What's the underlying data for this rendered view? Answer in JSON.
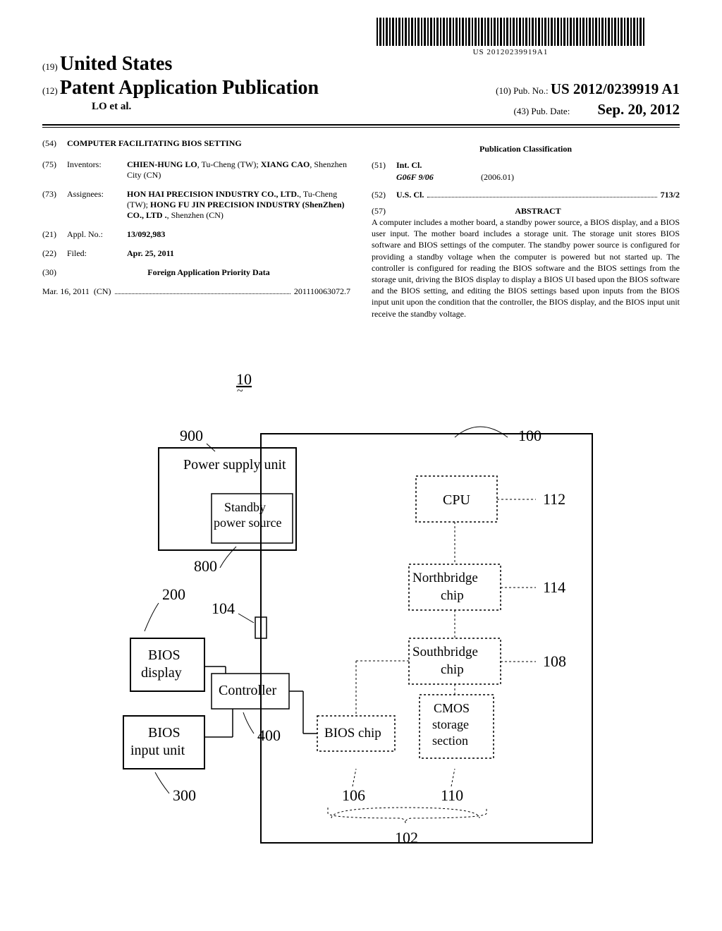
{
  "barcode_text": "US 20120239919A1",
  "country_code": "(19)",
  "country_name": "United States",
  "pub_type_code": "(12)",
  "pub_type": "Patent Application Publication",
  "pub_num_code": "(10)",
  "pub_num_label": "Pub. No.:",
  "pub_num_value": "US 2012/0239919 A1",
  "authors": "LO et al.",
  "pub_date_code": "(43)",
  "pub_date_label": "Pub. Date:",
  "pub_date_value": "Sep. 20, 2012",
  "title_code": "(54)",
  "title_value": "COMPUTER FACILITATING BIOS SETTING",
  "inventors_code": "(75)",
  "inventors_label": "Inventors:",
  "inventors_value_1": "CHIEN-HUNG LO",
  "inventors_loc_1": ", Tu-Cheng (TW); ",
  "inventors_value_2": "XIANG CAO",
  "inventors_loc_2": ", Shenzhen City (CN)",
  "assignees_code": "(73)",
  "assignees_label": "Assignees:",
  "assignees_value_1": "HON HAI PRECISION INDUSTRY CO., LTD.",
  "assignees_loc_1": ", Tu-Cheng (TW); ",
  "assignees_value_2": "HONG FU JIN PRECISION INDUSTRY (ShenZhen) CO., LTD .",
  "assignees_loc_2": ", Shenzhen (CN)",
  "applno_code": "(21)",
  "applno_label": "Appl. No.:",
  "applno_value": "13/092,983",
  "filed_code": "(22)",
  "filed_label": "Filed:",
  "filed_value": "Apr. 25, 2011",
  "foreign_code": "(30)",
  "foreign_label": "Foreign Application Priority Data",
  "foreign_date": "Mar. 16, 2011",
  "foreign_country": "(CN)",
  "foreign_num": "201110063072.7",
  "classification_heading": "Publication Classification",
  "intcl_code": "(51)",
  "intcl_label": "Int. Cl.",
  "intcl_class": "G06F 9/06",
  "intcl_year": "(2006.01)",
  "uscl_code": "(52)",
  "uscl_label": "U.S. Cl.",
  "uscl_value": "713/2",
  "abstract_code": "(57)",
  "abstract_label": "ABSTRACT",
  "abstract_text": "A computer includes a mother board, a standby power source, a BIOS display, and a BIOS user input. The mother board includes a storage unit. The storage unit stores BIOS software and BIOS settings of the computer. The standby power source is configured for providing a standby voltage when the computer is powered but not started up. The controller is configured for reading the BIOS software and the BIOS settings from the storage unit, driving the BIOS display to display a BIOS UI based upon the BIOS software and the BIOS setting, and editing the BIOS settings based upon inputs from the BIOS input unit upon the condition that the controller, the BIOS display, and the BIOS input unit receive the standby voltage.",
  "diagram": {
    "label_10": "10",
    "label_900": "900",
    "label_800": "800",
    "label_200": "200",
    "label_104": "104",
    "label_400": "400",
    "label_300": "300",
    "label_100": "100",
    "label_112": "112",
    "label_114": "114",
    "label_108": "108",
    "label_106": "106",
    "label_110": "110",
    "label_102": "102",
    "box_psu": "Power supply unit",
    "box_standby": "Standby power source",
    "box_bios_display": "BIOS display",
    "box_bios_input": "BIOS input unit",
    "box_controller": "Controller",
    "box_cpu": "CPU",
    "box_northbridge": "Northbridge chip",
    "box_southbridge": "Southbridge chip",
    "box_cmos": "CMOS storage section",
    "box_bios_chip": "BIOS chip"
  }
}
